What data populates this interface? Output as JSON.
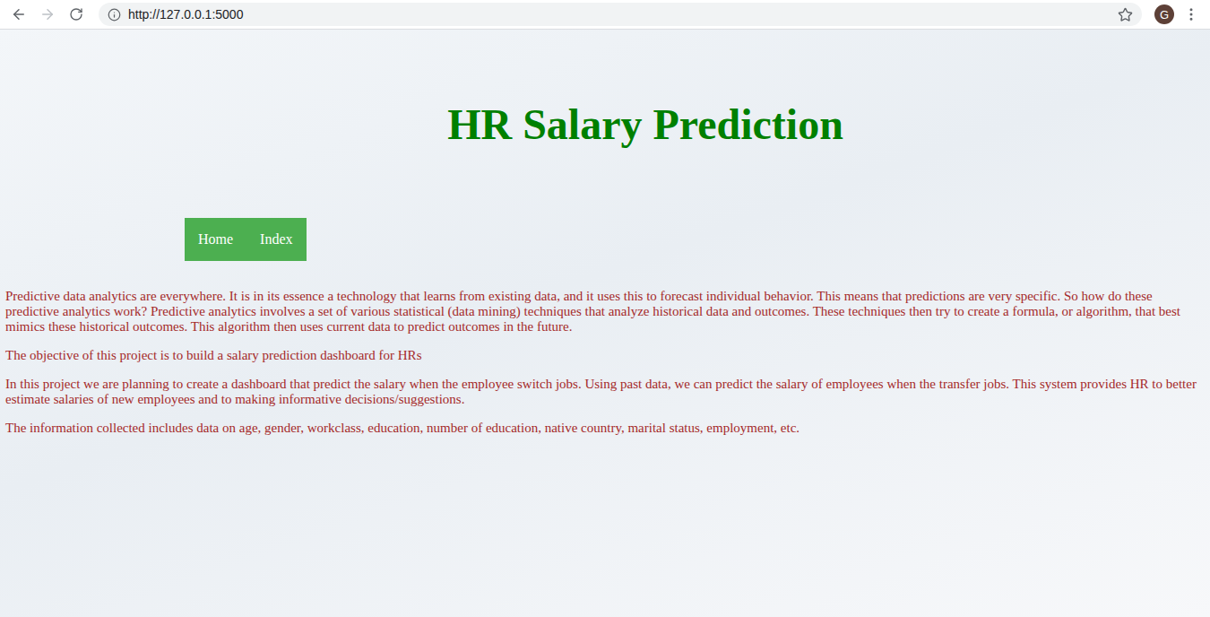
{
  "browser": {
    "url": "http://127.0.0.1:5000",
    "profile_initial": "G",
    "back": {
      "disabled": false
    },
    "forward": {
      "disabled": true
    },
    "bookmarked": false
  },
  "page": {
    "title": "HR Salary Prediction",
    "nav": [
      {
        "label": "Home"
      },
      {
        "label": "Index"
      }
    ],
    "paragraphs": [
      "Predictive data analytics are everywhere. It is in its essence a technology that learns from existing data, and it uses this to forecast individual behavior. This means that predictions are very specific. So how do these predictive analytics work? Predictive analytics involves a set of various statistical (data mining) techniques that analyze historical data and outcomes. These techniques then try to create a formula, or algorithm, that best mimics these historical outcomes. This algorithm then uses current data to predict outcomes in the future.",
      "The objective of this project is to build a salary prediction dashboard for HRs",
      "In this project we are planning to create a dashboard that predict the salary when the employee switch jobs. Using past data, we can predict the salary of employees when the transfer jobs. This system provides HR to better estimate salaries of new employees and to making informative decisions/suggestions.",
      "The information collected includes data on age, gender, workclass, education, number of education, native country, marital status, employment, etc."
    ]
  }
}
